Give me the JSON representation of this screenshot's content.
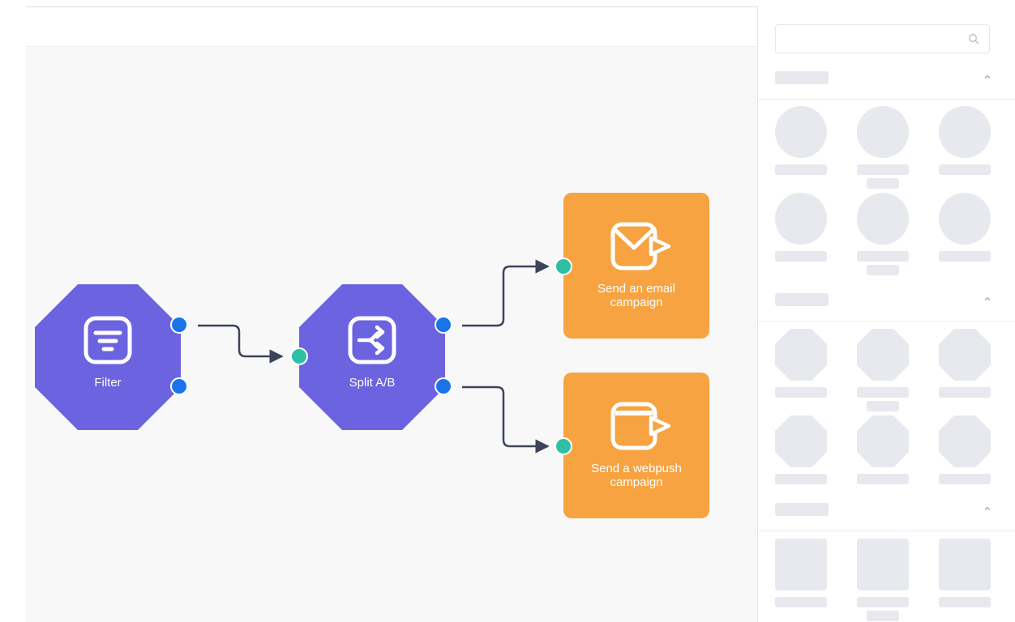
{
  "colors": {
    "trigger_node": "#6c63e0",
    "action_node": "#f7a341",
    "output_port": "#1a73e8",
    "input_port": "#2ebfa5",
    "edge": "#3d4459",
    "canvas_bg": "#f8f8f9",
    "placeholder": "#e7e9ee"
  },
  "sidebar": {
    "search": {
      "placeholder": "",
      "value": "",
      "icon": "search-icon"
    },
    "sections": [
      {
        "label": "",
        "collapse_icon": "chevron-up-icon",
        "tile_shape": "circle",
        "tile_count": 6
      },
      {
        "label": "",
        "collapse_icon": "chevron-up-icon",
        "tile_shape": "octagon",
        "tile_count": 6
      },
      {
        "label": "",
        "collapse_icon": "chevron-up-icon",
        "tile_shape": "square",
        "tile_count": 3
      }
    ]
  },
  "workflow": {
    "nodes": [
      {
        "id": "filter",
        "kind": "octagon",
        "label": "Filter",
        "icon": "filter-icon",
        "outputs": 2,
        "inputs": 0
      },
      {
        "id": "split",
        "kind": "octagon",
        "label": "Split A/B",
        "icon": "split-icon",
        "outputs": 2,
        "inputs": 1
      },
      {
        "id": "email",
        "kind": "action",
        "label": "Send an email\ncampaign",
        "icon": "email-send-icon",
        "inputs": 1
      },
      {
        "id": "webpush",
        "kind": "action",
        "label": "Send a webpush\ncampaign",
        "icon": "webpush-send-icon",
        "inputs": 1
      }
    ],
    "edges": [
      {
        "from": "filter.out1",
        "to": "split.in"
      },
      {
        "from": "split.out1",
        "to": "email.in"
      },
      {
        "from": "split.out2",
        "to": "webpush.in"
      }
    ]
  }
}
